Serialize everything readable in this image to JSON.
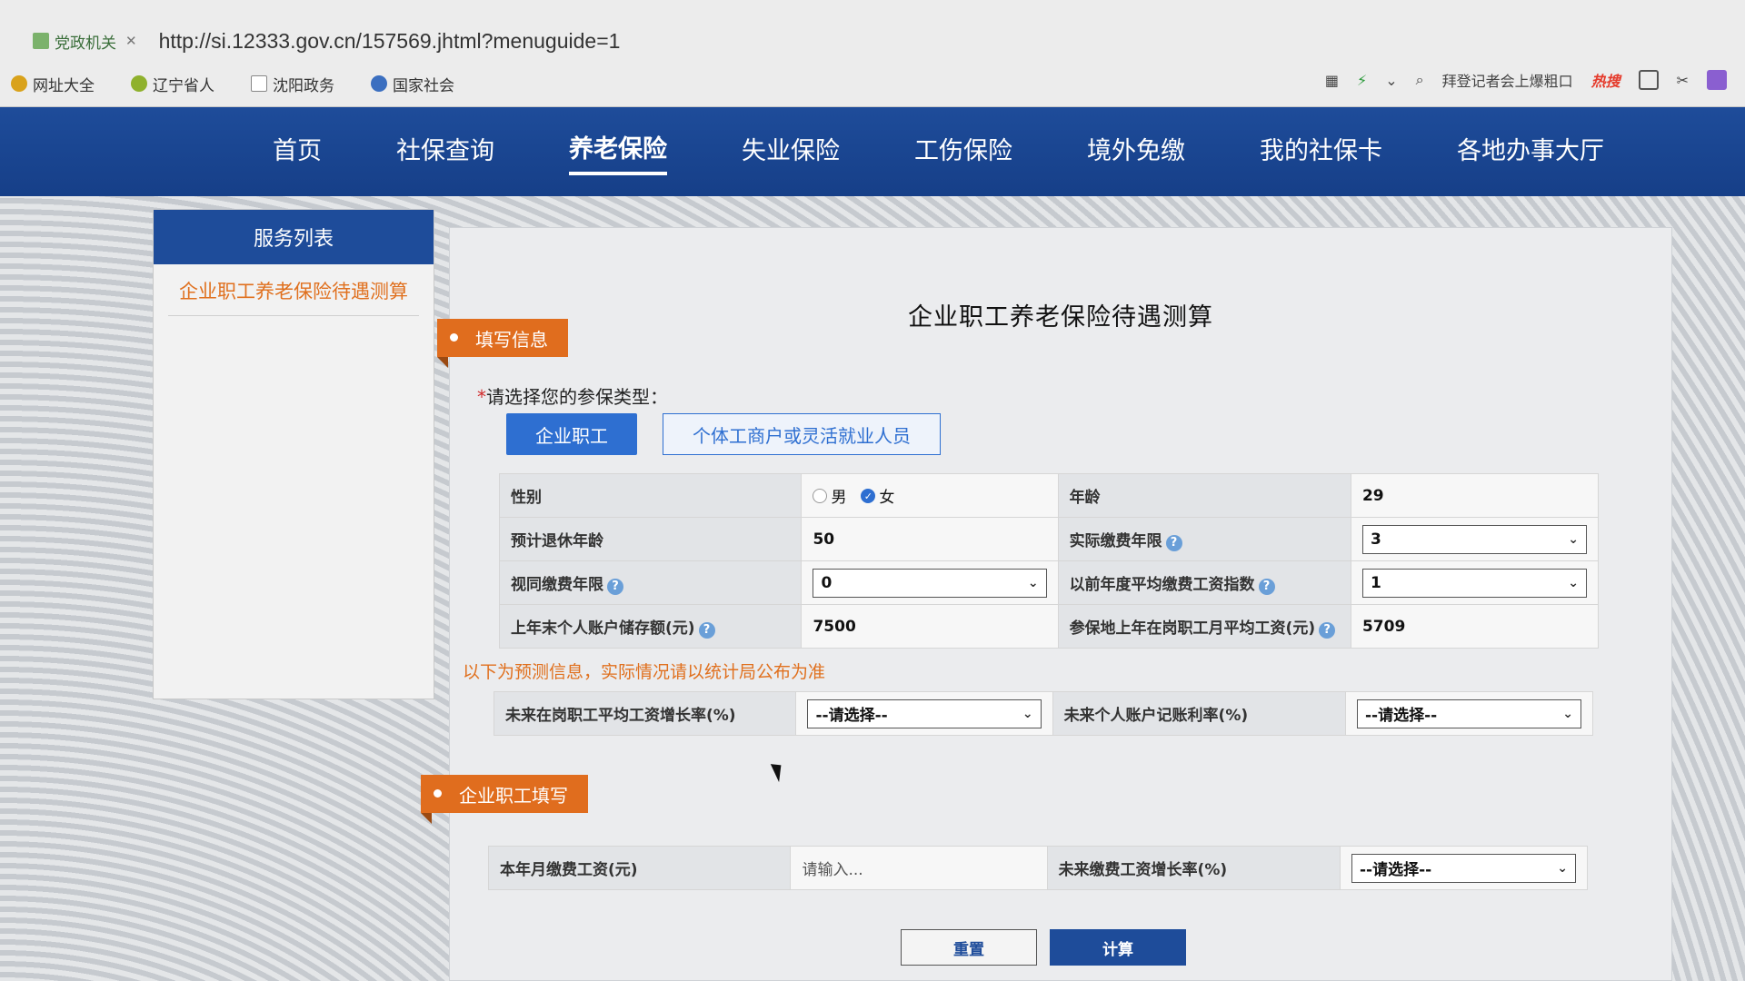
{
  "browser": {
    "tab_label": "党政机关",
    "url": "http://si.12333.gov.cn/157569.jhtml?menuguide=1",
    "bookmarks": [
      "网址大全",
      "辽宁省人",
      "沈阳政务",
      "国家社会"
    ],
    "search_hint": "拜登记者会上爆粗口",
    "hot_label": "热搜"
  },
  "nav": {
    "items": [
      "首页",
      "社保查询",
      "养老保险",
      "失业保险",
      "工伤保险",
      "境外免缴",
      "我的社保卡",
      "各地办事大厅"
    ],
    "active_index": 2
  },
  "sidebar": {
    "header": "服务列表",
    "items": [
      "企业职工养老保险待遇测算"
    ]
  },
  "main": {
    "title": "企业职工养老保险待遇测算",
    "section_fill": "填写信息",
    "type_prompt_req": "*",
    "type_prompt": "请选择您的参保类型：",
    "type_options": [
      "企业职工",
      "个体工商户或灵活就业人员"
    ],
    "form": {
      "gender_label": "性别",
      "gender_options": [
        "男",
        "女"
      ],
      "gender_selected": "女",
      "age_label": "年龄",
      "age_value": "29",
      "retire_age_label": "预计退休年龄",
      "retire_age_value": "50",
      "actual_years_label": "实际缴费年限",
      "actual_years_value": "3",
      "deemed_years_label": "视同缴费年限",
      "deemed_years_value": "0",
      "avg_index_label": "以前年度平均缴费工资指数",
      "avg_index_value": "1",
      "account_label": "上年末个人账户储存额(元)",
      "account_value": "7500",
      "avg_wage_label": "参保地上年在岗职工月平均工资(元)",
      "avg_wage_value": "5709"
    },
    "notice": "以下为预测信息，实际情况请以统计局公布为准",
    "forecast": {
      "wage_growth_label": "未来在岗职工平均工资增长率(%)",
      "wage_growth_value": "--请选择--",
      "interest_label": "未来个人账户记账利率(%)",
      "interest_value": "--请选择--"
    },
    "section_company": "企业职工填写",
    "company": {
      "monthly_wage_label": "本年月缴费工资(元)",
      "monthly_wage_placeholder": "请输入...",
      "future_growth_label": "未来缴费工资增长率(%)",
      "future_growth_value": "--请选择--"
    },
    "buttons": {
      "reset": "重置",
      "calculate": "计算"
    }
  }
}
